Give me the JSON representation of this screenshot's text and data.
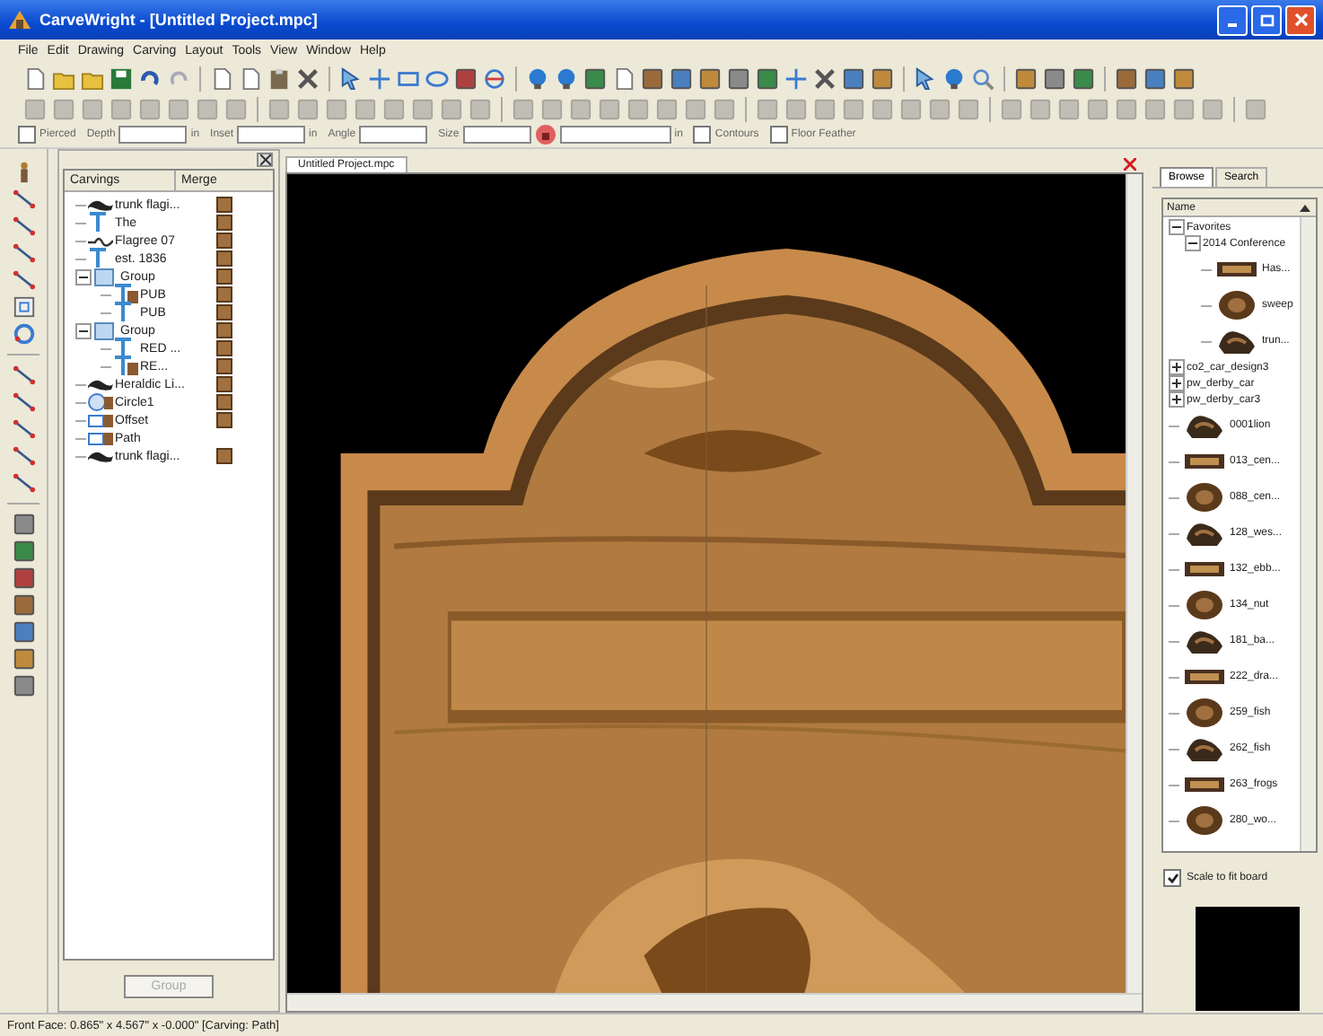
{
  "window": {
    "title": "CarveWright - [Untitled Project.mpc]"
  },
  "menu": [
    "File",
    "Edit",
    "Drawing",
    "Carving",
    "Layout",
    "Tools",
    "View",
    "Window",
    "Help"
  ],
  "options": [
    {
      "kind": "checkbox",
      "label": "Pierced",
      "checked": false
    },
    {
      "kind": "field",
      "label": "Depth",
      "unit": "in"
    },
    {
      "kind": "field",
      "label": "Inset",
      "unit": "in"
    },
    {
      "kind": "field",
      "label": "Angle"
    },
    {
      "kind": "size",
      "label": "Size",
      "unit": "in"
    },
    {
      "kind": "checkbox",
      "label": "Contours",
      "checked": false
    },
    {
      "kind": "checkbox",
      "label": "Floor Feather",
      "checked": false
    }
  ],
  "carvings": {
    "columns": [
      "Carvings",
      "Merge"
    ],
    "items": [
      {
        "kind": "bitmap",
        "label": "trunk flagi...",
        "merge": true
      },
      {
        "kind": "text",
        "label": "The",
        "merge": true
      },
      {
        "kind": "line",
        "label": "Flagree 07",
        "merge": true
      },
      {
        "kind": "text",
        "label": "est. 1836",
        "merge": true
      },
      {
        "kind": "group",
        "label": "Group",
        "merge": true,
        "expanded": true,
        "children": [
          {
            "kind": "text-pattern",
            "label": "PUB",
            "merge": true
          },
          {
            "kind": "text",
            "label": "PUB",
            "merge": true
          }
        ]
      },
      {
        "kind": "group",
        "label": "Group",
        "merge": true,
        "expanded": true,
        "children": [
          {
            "kind": "text",
            "label": "RED ...",
            "merge": true
          },
          {
            "kind": "text-pattern",
            "label": "RE...",
            "merge": true
          }
        ]
      },
      {
        "kind": "bitmap",
        "label": "Heraldic Li...",
        "merge": true
      },
      {
        "kind": "circle",
        "label": "Circle1",
        "merge": true
      },
      {
        "kind": "rect",
        "label": "Offset",
        "merge": true
      },
      {
        "kind": "rect",
        "label": "Path",
        "merge": false
      },
      {
        "kind": "bitmap",
        "label": "trunk flagi...",
        "merge": true
      }
    ],
    "button": {
      "label": "Group",
      "disabled": true
    }
  },
  "document_tab": {
    "label": "Untitled Project.mpc"
  },
  "library": {
    "tabs": [
      {
        "label": "Browse",
        "selected": true
      },
      {
        "label": "Search",
        "selected": false
      }
    ],
    "column": "Name",
    "items": [
      {
        "kind": "folder",
        "label": "Favorites",
        "expanded": true,
        "children": [
          {
            "kind": "folder",
            "label": "2014 Conference",
            "expanded": true,
            "children": [
              {
                "kind": "model",
                "label": "Has..."
              },
              {
                "kind": "model",
                "label": "sweep"
              },
              {
                "kind": "model",
                "label": "trun..."
              }
            ]
          }
        ]
      },
      {
        "kind": "folder",
        "label": "co2_car_design3",
        "expanded": false
      },
      {
        "kind": "folder",
        "label": "pw_derby_car",
        "expanded": false
      },
      {
        "kind": "folder",
        "label": "pw_derby_car3",
        "expanded": false
      },
      {
        "kind": "model",
        "label": "0001lion"
      },
      {
        "kind": "model",
        "label": "013_cen..."
      },
      {
        "kind": "model",
        "label": "088_cen..."
      },
      {
        "kind": "model",
        "label": "128_wes..."
      },
      {
        "kind": "model",
        "label": "132_ebb..."
      },
      {
        "kind": "model",
        "label": "134_nut"
      },
      {
        "kind": "model",
        "label": "181_ba..."
      },
      {
        "kind": "model",
        "label": "222_dra..."
      },
      {
        "kind": "model",
        "label": "259_fish"
      },
      {
        "kind": "model",
        "label": "262_fish"
      },
      {
        "kind": "model",
        "label": "263_frogs"
      },
      {
        "kind": "model",
        "label": "280_wo..."
      }
    ],
    "scale_to_fit": {
      "label": "Scale to fit board",
      "checked": true
    }
  },
  "status_bar": "Front Face: 0.865\" x 4.567\" x -0.000\"    [Carving: Path]"
}
